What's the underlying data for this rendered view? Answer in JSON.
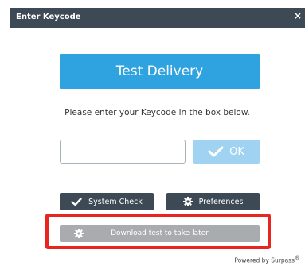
{
  "dialog": {
    "title": "Enter Keycode",
    "close_symbol": "×"
  },
  "banner": {
    "title": "Test Delivery",
    "color": "#2fa3df"
  },
  "instruction": "Please enter your Keycode in the box below.",
  "keycode_input": {
    "value": "",
    "placeholder": ""
  },
  "ok_button": {
    "label": "OK",
    "icon": "check-icon",
    "color": "#9fd3f1"
  },
  "system_check_button": {
    "label": "System Check",
    "icon": "check-icon"
  },
  "preferences_button": {
    "label": "Preferences",
    "icon": "gear-icon"
  },
  "download_button": {
    "label": "Download test to take later",
    "icon": "gear-icon"
  },
  "highlight": {
    "color": "#e8261f"
  },
  "footer": {
    "powered_by": "Powered by Surpass",
    "reg_mark": "®"
  }
}
